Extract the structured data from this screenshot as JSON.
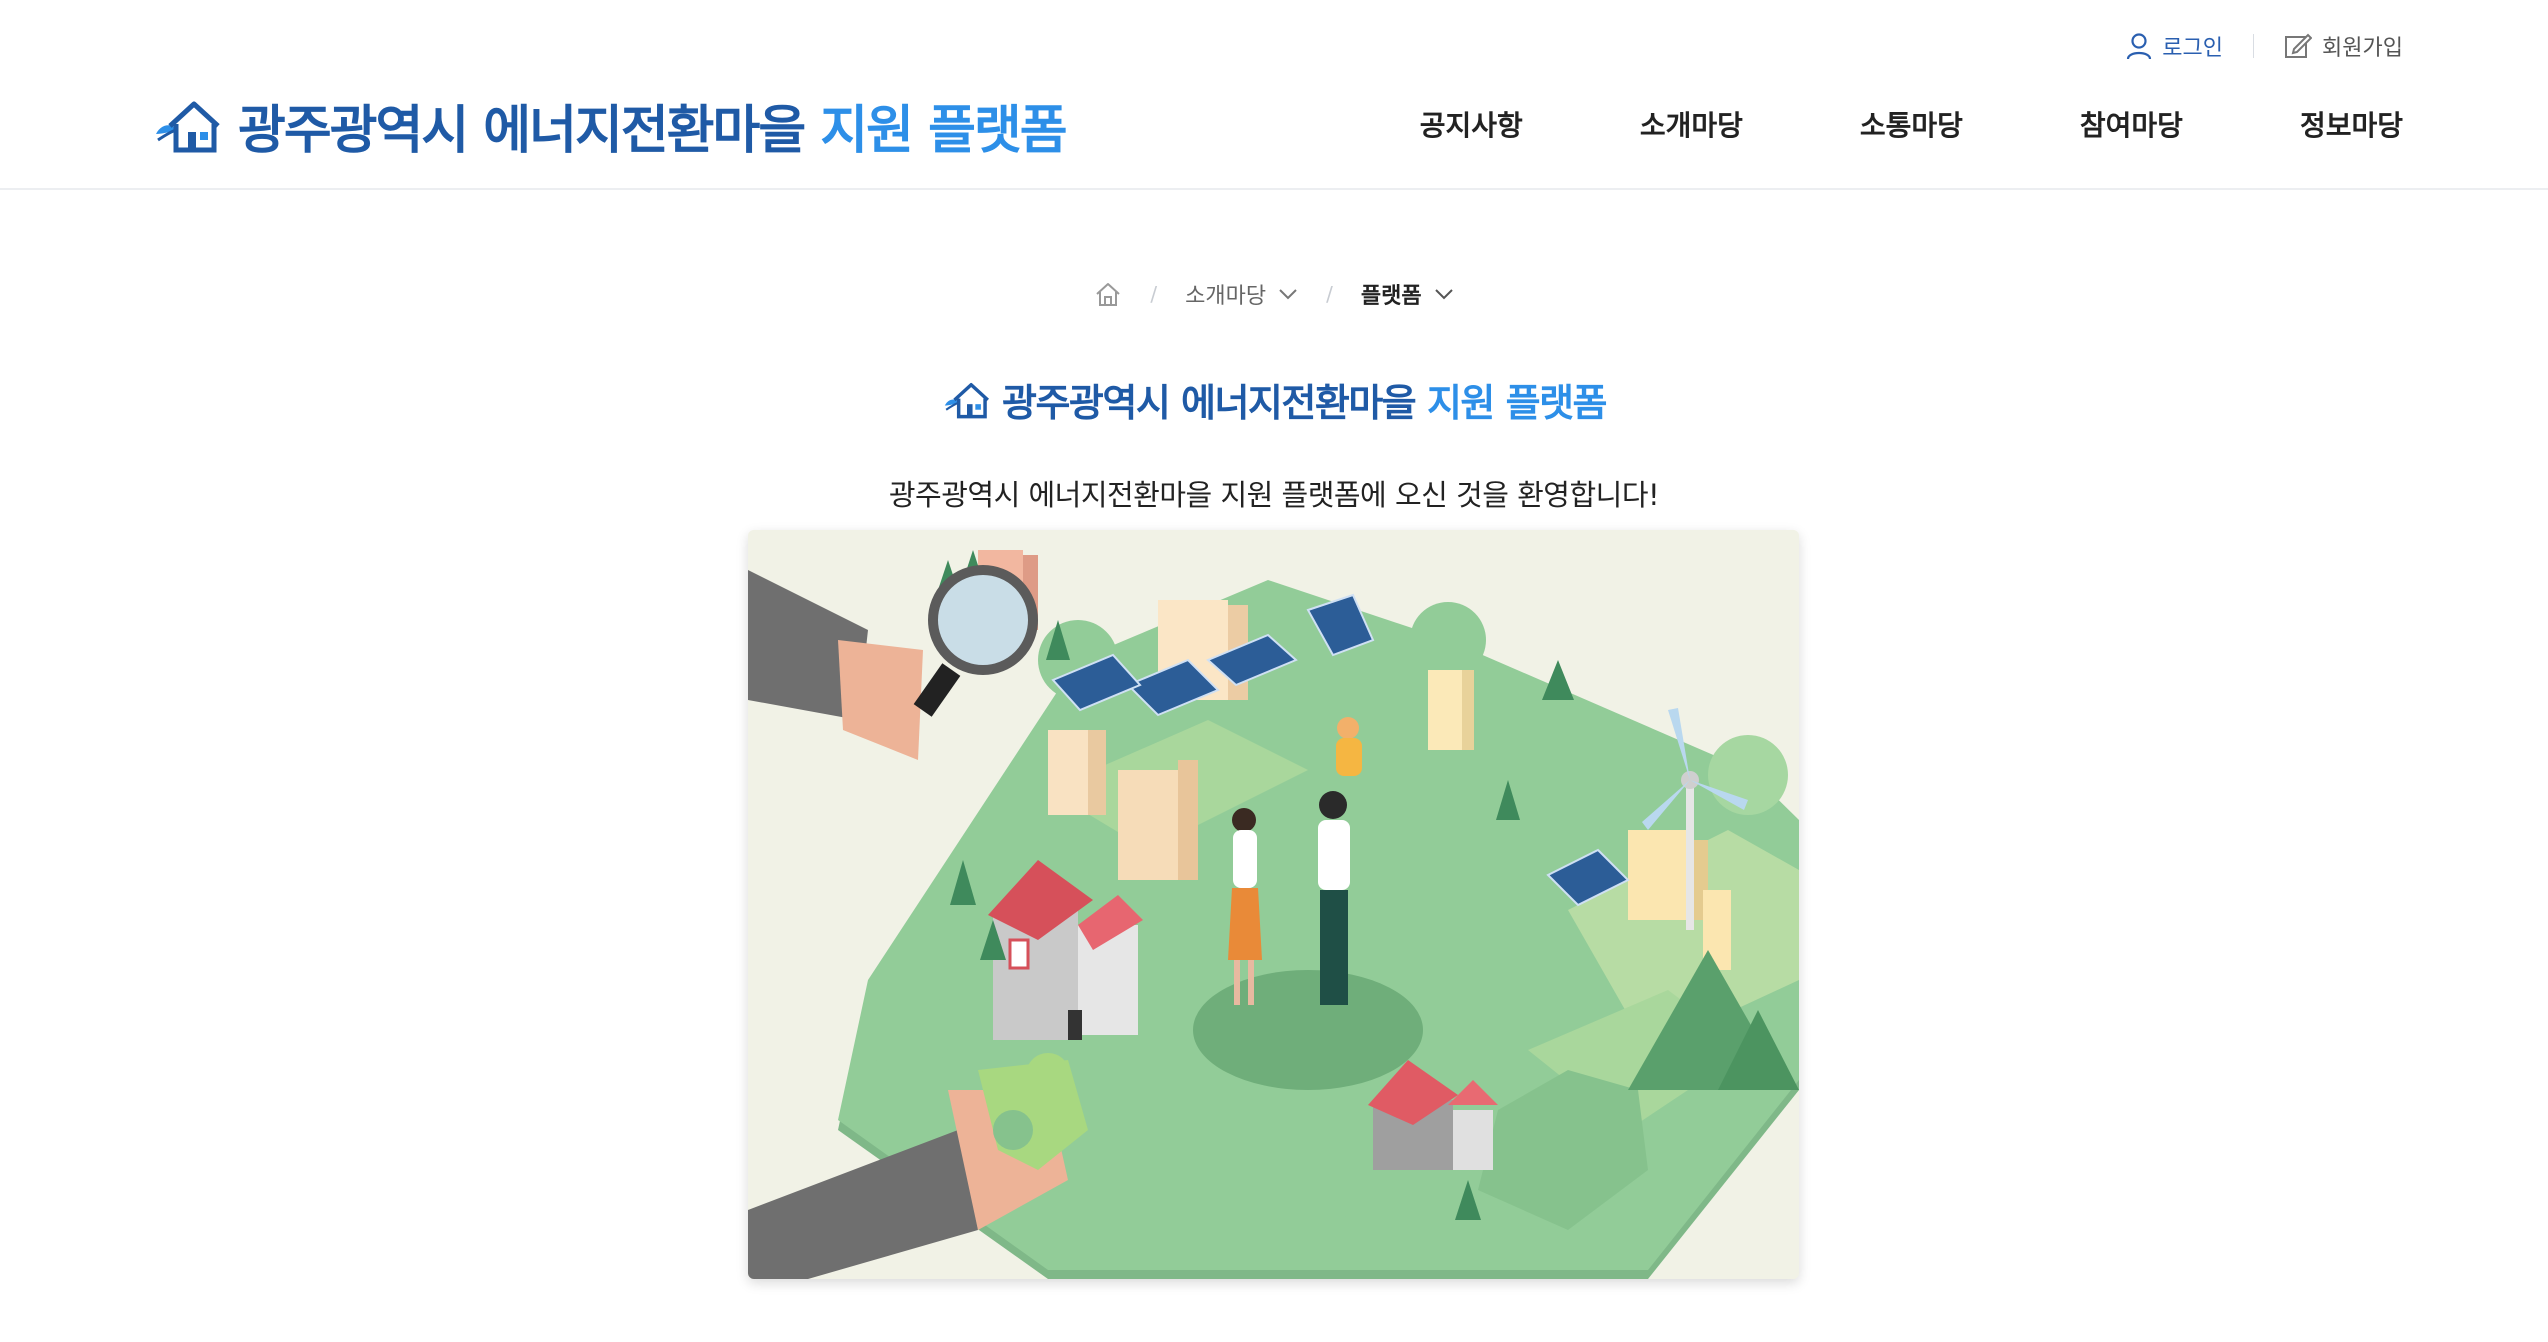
{
  "header": {
    "logo": {
      "main": "광주광역시 에너지전환마을 ",
      "highlight": "지원 플랫폼"
    },
    "util": {
      "login_label": "로그인",
      "join_label": "회원가입"
    },
    "nav": [
      {
        "label": "공지사항"
      },
      {
        "label": "소개마당"
      },
      {
        "label": "소통마당"
      },
      {
        "label": "참여마당"
      },
      {
        "label": "정보마당"
      }
    ]
  },
  "breadcrumb": {
    "items": [
      {
        "label": "소개마당"
      },
      {
        "label": "플랫폼"
      }
    ]
  },
  "intro": {
    "logo": {
      "main": "광주광역시 에너지전환마을 ",
      "highlight": "지원 플랫폼"
    },
    "welcome": "광주광역시 에너지전환마을 지원 플랫폼에 오신 것을 환영합니다!"
  },
  "colors": {
    "brand_dark": "#1f5aa6",
    "brand_light": "#2d8fe8",
    "puzzle_green": "#8cc890",
    "background": "#ffffff"
  }
}
